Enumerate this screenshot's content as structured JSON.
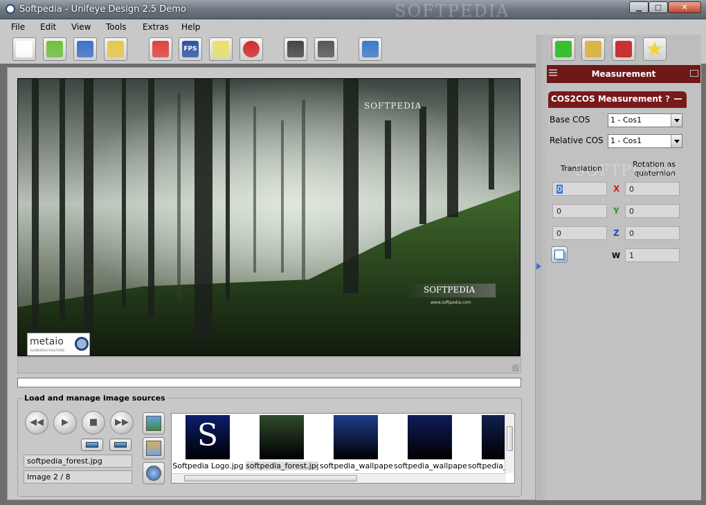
{
  "window": {
    "title": "Softpedia - Unifeye Design 2.5 Demo",
    "watermark": "SOFTPEDIA",
    "minimize": "▁",
    "maximize": "□",
    "close": "✕"
  },
  "menu": [
    "File",
    "Edit",
    "View",
    "Tools",
    "Extras",
    "Help"
  ],
  "toolbar": [
    {
      "icon": "new-document-icon",
      "color": "#ffffff"
    },
    {
      "icon": "open-icon",
      "color": "#6fbf3a"
    },
    {
      "icon": "save-icon",
      "color": "#3f6fc9"
    },
    {
      "icon": "save-as-icon",
      "color": "#e7c64a"
    },
    {
      "icon": "coordinate-system-icon",
      "color": "#e04040"
    },
    {
      "text": "FPS",
      "icon": "fps-icon",
      "color": "#2b53a6"
    },
    {
      "icon": "light-icon",
      "color": "#e8e06c"
    },
    {
      "icon": "no-render-icon",
      "color": "#d22a2a"
    },
    {
      "icon": "dot-grid-icon",
      "color": "#444444"
    },
    {
      "icon": "dot-grid-window-icon",
      "color": "#555555"
    },
    {
      "icon": "window-camera-icon",
      "color": "#3a7ac9"
    }
  ],
  "viewport": {
    "watermark_top": "SOFTPEDIA",
    "watermark_bottom": "SOFTPEDIA",
    "watermark_url": "www.softpedia.com",
    "logo": "metaio",
    "logo_sub": "AUGMENTED SOLUTIONS"
  },
  "sources": {
    "title": "Load and manage image sources",
    "transport": [
      "◀◀",
      "▶",
      "■",
      "▶▶"
    ],
    "filename": "softpedia_forest.jpg",
    "counter": "Image 2 / 8",
    "thumbnails": [
      {
        "caption": "Softpedia Logo.jpg",
        "selected": false,
        "color": "#0b1e6e"
      },
      {
        "caption": "softpedia_forest.jpg",
        "selected": true,
        "color": "#2f4a2d"
      },
      {
        "caption": "softpedia_wallpape...",
        "selected": false,
        "color": "#1f3c8c"
      },
      {
        "caption": "softpedia_wallpape...",
        "selected": false,
        "color": "#101c5c"
      },
      {
        "caption": "softpedia_wallpape...",
        "selected": false,
        "color": "#10204f"
      }
    ]
  },
  "right_toolbar": [
    {
      "icon": "cube-icon",
      "color": "#3cbf2e"
    },
    {
      "icon": "ruler-icon",
      "color": "#d8b64a"
    },
    {
      "icon": "tools-icon",
      "color": "#c93232"
    },
    {
      "icon": "star-icon",
      "color": "#f2d533"
    }
  ],
  "measurement": {
    "header": "Measurement",
    "panel_title": "COS2COS Measurement",
    "help": "?",
    "base_cos_label": "Base COS",
    "base_cos_value": "1 - Cos1",
    "relative_cos_label": "Relative COS",
    "relative_cos_value": "1 - Cos1",
    "translation_label": "Translation",
    "rotation_label_1": "Rotation as",
    "rotation_label_2": "quaternion",
    "watermark": "SOFTPEDIA",
    "translation": [
      "0",
      "0",
      "0"
    ],
    "rotation": [
      "0",
      "0",
      "0",
      "1"
    ],
    "axes": [
      "X",
      "Y",
      "Z",
      "W"
    ],
    "axis_colors": [
      "#d21e1e",
      "#2a9a2a",
      "#2342c8",
      "#000000"
    ]
  }
}
